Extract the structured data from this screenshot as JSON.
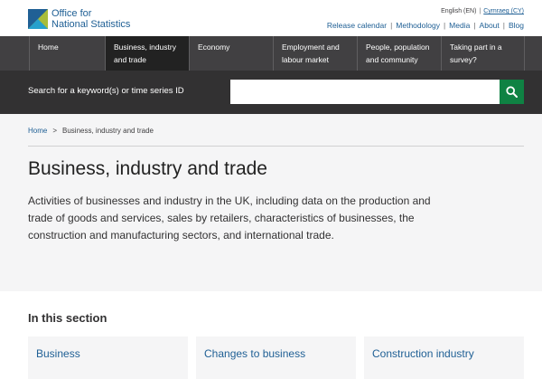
{
  "header": {
    "logo": {
      "line1": "Office for",
      "line2": "National Statistics"
    },
    "language": {
      "english": "English (EN)",
      "welsh": "Cymraeg (CY)"
    },
    "links": [
      "Release calendar",
      "Methodology",
      "Media",
      "About",
      "Blog"
    ]
  },
  "nav": {
    "items": [
      {
        "line1": "Home",
        "line2": ""
      },
      {
        "line1": "Business, industry",
        "line2": "and trade"
      },
      {
        "line1": "Economy",
        "line2": ""
      },
      {
        "line1": "Employment and",
        "line2": "labour market"
      },
      {
        "line1": "People, population",
        "line2": "and community"
      },
      {
        "line1": "Taking part in a",
        "line2": "survey?"
      }
    ]
  },
  "search": {
    "label": "Search for a keyword(s) or time series ID",
    "value": "",
    "placeholder": ""
  },
  "breadcrumb": {
    "home": "Home",
    "separator": ">",
    "current": "Business, industry and trade"
  },
  "page": {
    "title": "Business, industry and trade",
    "description": "Activities of businesses and industry in the UK, including data on the production and trade of goods and services, sales by retailers, characteristics of businesses, the construction and manufacturing sectors, and international trade."
  },
  "section": {
    "heading": "In this section",
    "cards": [
      "Business",
      "Changes to business",
      "Construction industry"
    ]
  },
  "colors": {
    "brand_blue": "#206095",
    "nav_bg": "#414042",
    "nav_active": "#222222",
    "search_band": "#323132",
    "search_button": "#0f8243",
    "banner_bg": "#f5f5f6"
  },
  "icons": {
    "logo": "ons-logo-icon",
    "search": "search-icon"
  }
}
